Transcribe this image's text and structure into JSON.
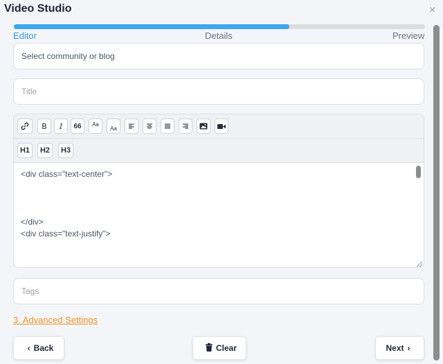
{
  "app": {
    "title": "Video Studio",
    "close_glyph": "×"
  },
  "progress": {
    "fraction": 0.67,
    "fill_color": "#3ea7f0"
  },
  "steps": [
    {
      "label": "Editor",
      "active": true
    },
    {
      "label": "Details",
      "active": false
    },
    {
      "label": "Preview",
      "active": false
    }
  ],
  "form": {
    "community_value": "Select community or blog",
    "title_placeholder": "Title",
    "tags_placeholder": "Tags"
  },
  "toolbar": {
    "buttons": [
      {
        "name": "link-icon",
        "glyph": "🔗"
      },
      {
        "name": "bold-icon",
        "glyph": "B"
      },
      {
        "name": "italic-icon",
        "glyph": "I"
      },
      {
        "name": "quote-icon",
        "glyph": "❝"
      },
      {
        "name": "superscript-icon",
        "glyph": "ᴬᵃ"
      },
      {
        "name": "subscript-icon",
        "glyph": "Aa"
      },
      {
        "name": "align-left-icon",
        "glyph": "☰"
      },
      {
        "name": "align-center-icon",
        "glyph": "☰"
      },
      {
        "name": "align-justify-icon",
        "glyph": "☰"
      },
      {
        "name": "align-right-icon",
        "glyph": "☰"
      },
      {
        "name": "image-icon",
        "glyph": "▣"
      },
      {
        "name": "video-icon",
        "glyph": "■"
      }
    ],
    "headings": [
      "H1",
      "H2",
      "H3"
    ]
  },
  "editor": {
    "lines": [
      "<div class=\"text-center\">",
      "</div>",
      "<div class=\"text-justify\">"
    ]
  },
  "advanced_link": "3. Advanced Settings",
  "buttons": {
    "back": "Back",
    "back_icon": "‹",
    "clear": "Clear",
    "clear_icon": "🗑",
    "next": "Next",
    "next_icon": "›"
  },
  "colors": {
    "accent_blue": "#2d9be6",
    "link_orange": "#f0932b"
  }
}
